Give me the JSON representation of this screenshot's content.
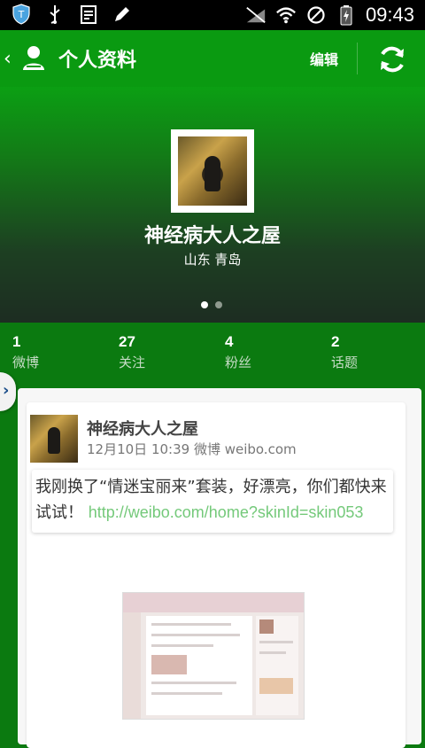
{
  "status_bar": {
    "time": "09:43"
  },
  "app_bar": {
    "title": "个人资料",
    "edit_label": "编辑"
  },
  "profile": {
    "name": "神经病大人之屋",
    "location": "山东 青岛"
  },
  "stats": [
    {
      "count": "1",
      "label": "微博"
    },
    {
      "count": "27",
      "label": "关注"
    },
    {
      "count": "4",
      "label": "粉丝"
    },
    {
      "count": "2",
      "label": "话题"
    }
  ],
  "post": {
    "author": "神经病大人之屋",
    "meta": "12月10日 10:39  微博 weibo.com",
    "text": "我刚换了“情迷宝丽来”套装，好漂亮，你们都快来试试！",
    "link": "http://weibo.com/home?skinId=skin053"
  },
  "colors": {
    "primary_green": "#0a9a11",
    "link_green": "#74c97a"
  }
}
